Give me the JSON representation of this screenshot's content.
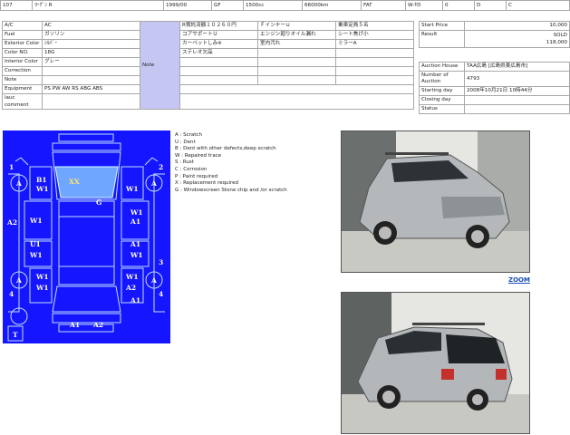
{
  "top_strip": [
    "107",
    "ﾖｰｸﾞﾝ R",
    "1999/00",
    "GF",
    "1500cc",
    "66000km",
    "FAT",
    "W-ｷD",
    "0",
    "D",
    "C"
  ],
  "spec": {
    "ac_label": "A/C",
    "ac": "AC",
    "fuel_label": "Fuel",
    "fuel": "ガソリン",
    "ext_color_label": "Exterior Color",
    "ext_color": "ｼﾙﾊﾞｰ",
    "color_no_label": "Color NO.",
    "color_no": "18G",
    "int_color_label": "Interior Color",
    "int_color": "グレー",
    "correction_label": "Correction",
    "note_label": "Note",
    "equipment_label": "Equipment",
    "equipment": "PS PW AW RS ABG ABS",
    "comment_label": "lauc comment",
    "note_mid_label": "Note",
    "notes": [
      "R預託済額１０２６０円",
      "コアサポートＵ",
      "カーペットしみ※",
      "ステレオ欠品"
    ],
    "notes2": [
      "Ｆインナーｕ",
      "エンジン廻りオイル漏れ",
      "室内汚れ"
    ],
    "notes3": [
      "乗車定員５名",
      "シート焦げ小",
      "ミラーA"
    ]
  },
  "price": {
    "start_label": "Start Price",
    "start": "10,000",
    "result_label": "Result",
    "result_status": "SOLD",
    "result": "118,000"
  },
  "auction": {
    "house_label": "Auction House",
    "house": "TAA広島 [広島県東広島市]",
    "number_label": "Number of Auction",
    "number": "4793",
    "starting_label": "Starting day",
    "starting": "2008年10月21日 10時44分",
    "closing_label": "Closing day",
    "closing": "",
    "status_label": "Status",
    "status": ""
  },
  "damage_legend": [
    "A : Scratch",
    "U : Dent",
    "B : Dent with other defects,deep scratch",
    "W : Repaired trace",
    "S : Rust",
    "C : Corrosion",
    "P : Paint required",
    "X : Replacement required",
    "G : Windowscreen Stone chip and /or scratch"
  ],
  "sheet_marks": {
    "n1": "1",
    "n2": "2",
    "n3": "3",
    "n4a": "4",
    "n4b": "4",
    "t": "T",
    "b1": "B1",
    "w1a": "W1",
    "xx": "XX",
    "g": "G",
    "w1b": "W1",
    "a1a": "A1",
    "a2a": "A2",
    "w1c": "W1",
    "w1d": "W1",
    "a1b": "A1",
    "u1": "U1",
    "w1e": "W1",
    "a1c": "A1",
    "w1f": "W1",
    "w1g": "W1",
    "w1h": "W1",
    "w1i": "W1",
    "a2b": "A2",
    "a1d": "A1",
    "a2c": "A2",
    "wa": "A",
    "wb": "A",
    "wc": "A",
    "wd": "A"
  },
  "zoom_label": "ZOOM",
  "colors": {
    "sheet_bg": "#1515ff",
    "note_bg": "#c6c6f2",
    "link": "#1a4fb4"
  }
}
